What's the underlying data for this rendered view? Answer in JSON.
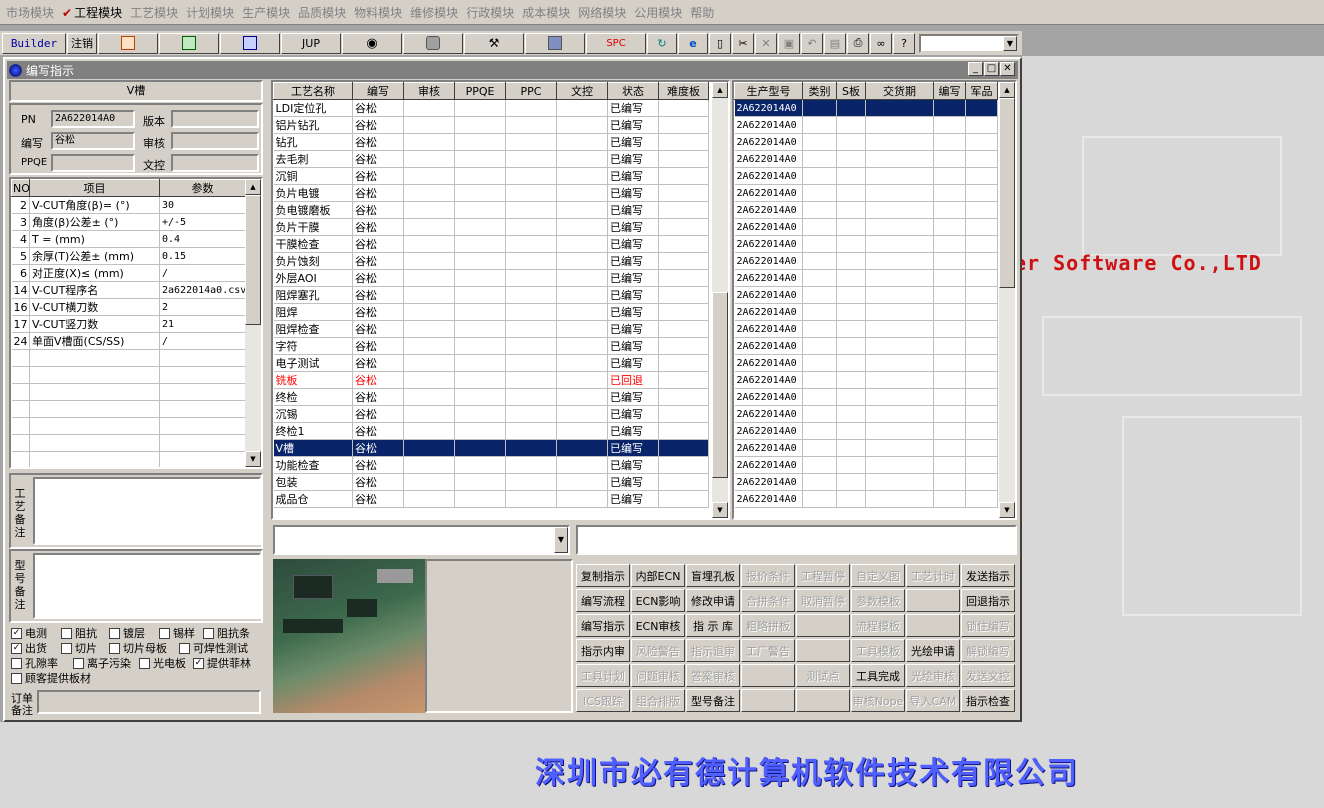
{
  "menu": [
    {
      "label": "市场模块",
      "active": false
    },
    {
      "label": "工程模块",
      "active": true
    },
    {
      "label": "工艺模块",
      "active": false
    },
    {
      "label": "计划模块",
      "active": false
    },
    {
      "label": "生产模块",
      "active": false
    },
    {
      "label": "品质模块",
      "active": false
    },
    {
      "label": "物料模块",
      "active": false
    },
    {
      "label": "维修模块",
      "active": false
    },
    {
      "label": "行政模块",
      "active": false
    },
    {
      "label": "成本模块",
      "active": false
    },
    {
      "label": "网络模块",
      "active": false
    },
    {
      "label": "公用模块",
      "active": false
    },
    {
      "label": "帮助",
      "active": false
    }
  ],
  "toolbar": {
    "builder": "Builder",
    "logout": "注销",
    "jup": "JUP",
    "spc": "SPC"
  },
  "window": {
    "title": "编写指示"
  },
  "left": {
    "section_title": "V槽",
    "pn_label": "PN",
    "pn_value": "2A622014A0",
    "version_label": "版本",
    "version_value": "",
    "writer_label": "编写",
    "writer_value": "谷松",
    "review_label": "审核",
    "review_value": "",
    "ppqe_label": "PPQE",
    "ppqe_value": "",
    "doc_label": "文控",
    "doc_value": "",
    "param_headers": [
      "NO",
      "项目",
      "参数"
    ],
    "params": [
      {
        "no": "2",
        "item": "V-CUT角度(β)=  (°)",
        "value": "30"
      },
      {
        "no": "3",
        "item": "角度(β)公差±  (°)",
        "value": "+/-5"
      },
      {
        "no": "4",
        "item": "T =  (mm)",
        "value": "0.4"
      },
      {
        "no": "5",
        "item": "余厚(T)公差±  (mm)",
        "value": "0.15"
      },
      {
        "no": "6",
        "item": "对正度(X)≤ (mm)",
        "value": "/"
      },
      {
        "no": "14",
        "item": "V-CUT程序名",
        "value": "2a622014a0.csv"
      },
      {
        "no": "16",
        "item": "V-CUT横刀数",
        "value": "2"
      },
      {
        "no": "17",
        "item": "V-CUT竖刀数",
        "value": "21"
      },
      {
        "no": "24",
        "item": "单面V槽面(CS/SS)",
        "value": "/"
      }
    ],
    "process_note_label": "工艺备注",
    "model_note_label": "型号备注",
    "checkboxes": [
      {
        "label": "电测",
        "checked": true
      },
      {
        "label": "阻抗",
        "checked": false
      },
      {
        "label": "镀层",
        "checked": false
      },
      {
        "label": "锡样",
        "checked": false
      },
      {
        "label": "阻抗条",
        "checked": false
      },
      {
        "label": "出货",
        "checked": true
      },
      {
        "label": "切片",
        "checked": false
      },
      {
        "label": "切片母板",
        "checked": false
      },
      {
        "label": "可焊性测试",
        "checked": false
      },
      {
        "label": "孔隙率",
        "checked": false
      },
      {
        "label": "离子污染",
        "checked": false
      },
      {
        "label": "光电板",
        "checked": false
      },
      {
        "label": "提供菲林",
        "checked": true
      },
      {
        "label": "顾客提供板材",
        "checked": false
      }
    ],
    "order_note_label": "订单备注"
  },
  "process_table": {
    "headers": [
      "工艺名称",
      "编写",
      "审核",
      "PPQE",
      "PPC",
      "文控",
      "状态",
      "难度板"
    ],
    "rows": [
      {
        "name": "LDI定位孔",
        "writer": "谷松",
        "status": "已编写"
      },
      {
        "name": "铝片钻孔",
        "writer": "谷松",
        "status": "已编写"
      },
      {
        "name": "钻孔",
        "writer": "谷松",
        "status": "已编写"
      },
      {
        "name": "去毛刺",
        "writer": "谷松",
        "status": "已编写"
      },
      {
        "name": "沉铜",
        "writer": "谷松",
        "status": "已编写"
      },
      {
        "name": "负片电镀",
        "writer": "谷松",
        "status": "已编写"
      },
      {
        "name": "负电镀磨板",
        "writer": "谷松",
        "status": "已编写"
      },
      {
        "name": "负片干膜",
        "writer": "谷松",
        "status": "已编写"
      },
      {
        "name": "干膜检查",
        "writer": "谷松",
        "status": "已编写"
      },
      {
        "name": "负片蚀刻",
        "writer": "谷松",
        "status": "已编写"
      },
      {
        "name": "外层AOI",
        "writer": "谷松",
        "status": "已编写"
      },
      {
        "name": "阻焊塞孔",
        "writer": "谷松",
        "status": "已编写"
      },
      {
        "name": "阻焊",
        "writer": "谷松",
        "status": "已编写"
      },
      {
        "name": "阻焊检查",
        "writer": "谷松",
        "status": "已编写"
      },
      {
        "name": "字符",
        "writer": "谷松",
        "status": "已编写"
      },
      {
        "name": "电子测试",
        "writer": "谷松",
        "status": "已编写"
      },
      {
        "name": "铣板",
        "writer": "谷松",
        "status": "已回退",
        "state": "red"
      },
      {
        "name": "终检",
        "writer": "谷松",
        "status": "已编写"
      },
      {
        "name": "沉锡",
        "writer": "谷松",
        "status": "已编写"
      },
      {
        "name": "终检1",
        "writer": "谷松",
        "status": "已编写"
      },
      {
        "name": "V槽",
        "writer": "谷松",
        "status": "已编写",
        "state": "sel"
      },
      {
        "name": "功能检查",
        "writer": "谷松",
        "status": "已编写"
      },
      {
        "name": "包装",
        "writer": "谷松",
        "status": "已编写"
      },
      {
        "name": "成品仓",
        "writer": "谷松",
        "status": "已编写"
      }
    ]
  },
  "model_table": {
    "headers": [
      "生产型号",
      "类别",
      "S板",
      "交货期",
      "编写",
      "军品"
    ],
    "rows": [
      "2A622014A0",
      "2A622014A0",
      "2A622014A0",
      "2A622014A0",
      "2A622014A0",
      "2A622014A0",
      "2A622014A0",
      "2A622014A0",
      "2A622014A0",
      "2A622014A0",
      "2A622014A0",
      "2A622014A0",
      "2A622014A0",
      "2A622014A0",
      "2A622014A0",
      "2A622014A0",
      "2A622014A0",
      "2A622014A0",
      "2A622014A0",
      "2A622014A0",
      "2A622014A0",
      "2A622014A0",
      "2A622014A0",
      "2A622014A0"
    ]
  },
  "buttons": [
    [
      {
        "label": "复制指示",
        "enabled": true
      },
      {
        "label": "内部ECN",
        "enabled": true
      },
      {
        "label": "盲埋孔板",
        "enabled": true
      },
      {
        "label": "报价条件",
        "enabled": false
      },
      {
        "label": "工程暂停",
        "enabled": false
      },
      {
        "label": "自定义图",
        "enabled": false
      },
      {
        "label": "工艺计时",
        "enabled": false
      },
      {
        "label": "发送指示",
        "enabled": true
      }
    ],
    [
      {
        "label": "编写流程",
        "enabled": true
      },
      {
        "label": "ECN影响",
        "enabled": true
      },
      {
        "label": "修改申请",
        "enabled": true
      },
      {
        "label": "合拼条件",
        "enabled": false
      },
      {
        "label": "取消暂停",
        "enabled": false
      },
      {
        "label": "参数模板",
        "enabled": false
      },
      {
        "label": "",
        "enabled": false
      },
      {
        "label": "回退指示",
        "enabled": true
      }
    ],
    [
      {
        "label": "编写指示",
        "enabled": true
      },
      {
        "label": "ECN审核",
        "enabled": true
      },
      {
        "label": "指 示 库",
        "enabled": true
      },
      {
        "label": "粗略拼板",
        "enabled": false
      },
      {
        "label": "",
        "enabled": false
      },
      {
        "label": "流程模板",
        "enabled": false
      },
      {
        "label": "",
        "enabled": false
      },
      {
        "label": "锁住编写",
        "enabled": false
      }
    ],
    [
      {
        "label": "指示内审",
        "enabled": true
      },
      {
        "label": "风险警告",
        "enabled": false
      },
      {
        "label": "指示退审",
        "enabled": false
      },
      {
        "label": "工厂警告",
        "enabled": false
      },
      {
        "label": "",
        "enabled": false
      },
      {
        "label": "工具模板",
        "enabled": false
      },
      {
        "label": "光绘申请",
        "enabled": true
      },
      {
        "label": "解锁编写",
        "enabled": false
      }
    ],
    [
      {
        "label": "工具计划",
        "enabled": false
      },
      {
        "label": "问题审核",
        "enabled": false
      },
      {
        "label": "答案审核",
        "enabled": false
      },
      {
        "label": "",
        "enabled": false
      },
      {
        "label": "测试点",
        "enabled": false
      },
      {
        "label": "工具完成",
        "enabled": true
      },
      {
        "label": "光绘审核",
        "enabled": false
      },
      {
        "label": "发送文控",
        "enabled": false
      }
    ],
    [
      {
        "label": "ICS跟踪",
        "enabled": false
      },
      {
        "label": "组合排版",
        "enabled": false
      },
      {
        "label": "型号备注",
        "enabled": true
      },
      {
        "label": "",
        "enabled": false
      },
      {
        "label": "",
        "enabled": false
      },
      {
        "label": "审核Nope",
        "enabled": false
      },
      {
        "label": "导入CAM",
        "enabled": false
      },
      {
        "label": "指示检查",
        "enabled": true
      }
    ]
  ],
  "background": {
    "software_text": "er Software Co.,LTD",
    "company_text": "深圳市必有德计算机软件技术有限公司"
  }
}
